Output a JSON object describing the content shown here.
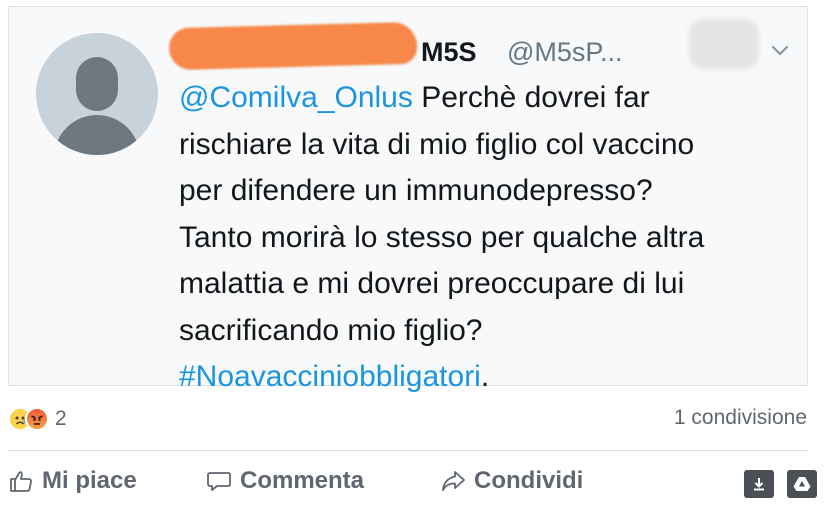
{
  "tweet": {
    "display_name": "M5S",
    "handle": "@M5sP...",
    "mention": "@Comilva_Onlus",
    "body": " Perchè dovrei far\nrischiare la vita di mio figlio col vaccino\nper difendere un immunodepresso?\nTanto morirà lo stesso per qualche altra\nmalattia e mi dovrei preoccupare di lui\nsacrificando mio figlio?\n",
    "hashtag": "#Noavacciniobbligatori",
    "trailing": ".",
    "redaction_color": "#f7884a",
    "link_color": "#1b95e0"
  },
  "post": {
    "reaction_icons": [
      "sad-emoji-icon",
      "angry-emoji-icon"
    ],
    "reaction_count": "2",
    "shares": "1 condivisione"
  },
  "actions": {
    "like_label": "Mi piace",
    "comment_label": "Commenta",
    "share_label": "Condividi"
  },
  "corner_icons": [
    "download-icon",
    "drive-icon"
  ]
}
